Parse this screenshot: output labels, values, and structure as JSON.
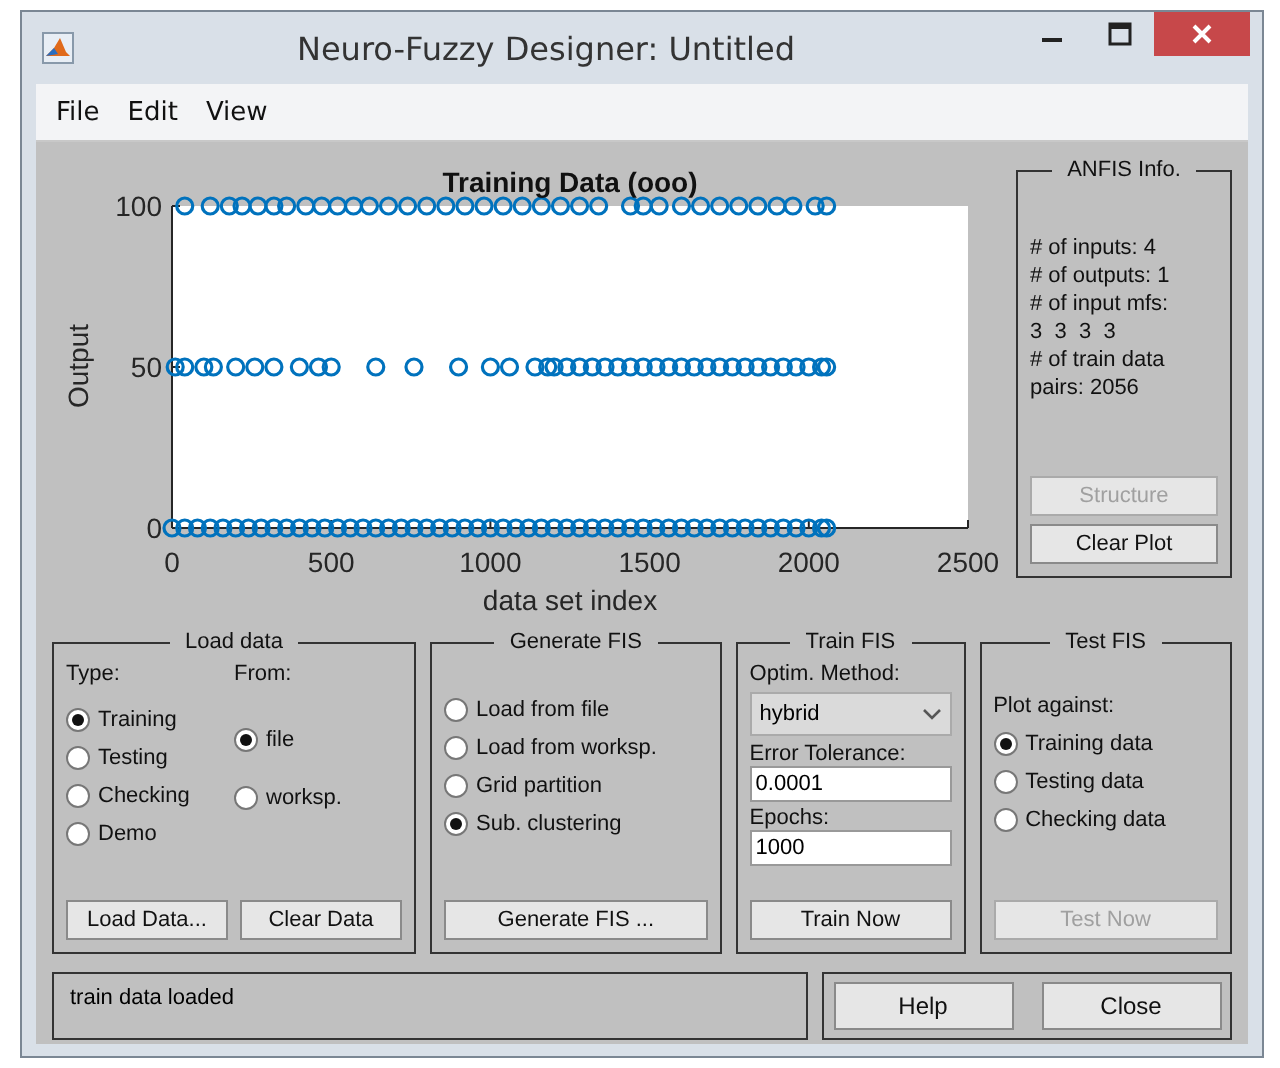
{
  "window": {
    "title": "Neuro-Fuzzy Designer: Untitled"
  },
  "menu": [
    "File",
    "Edit",
    "View"
  ],
  "plot": {
    "chart_data": {
      "type": "scatter",
      "title": "Training Data (ooo)",
      "xlabel": "data set index",
      "ylabel": "Output",
      "xlim": [
        0,
        2500
      ],
      "ylim": [
        0,
        100
      ],
      "xticks": [
        0,
        500,
        1000,
        1500,
        2000,
        2500
      ],
      "yticks": [
        0,
        50,
        100
      ],
      "series": [
        {
          "color": "#0072bd",
          "x": [
            0,
            40,
            80,
            120,
            160,
            200,
            240,
            280,
            320,
            360,
            400,
            440,
            480,
            520,
            560,
            600,
            640,
            680,
            720,
            760,
            800,
            840,
            880,
            920,
            960,
            1000,
            1040,
            1080,
            1120,
            1160,
            1200,
            1240,
            1280,
            1320,
            1360,
            1400,
            1440,
            1480,
            1520,
            1560,
            1600,
            1640,
            1680,
            1720,
            1760,
            1800,
            1840,
            1880,
            1920,
            1960,
            2000,
            2040,
            2056
          ],
          "values": [
            0,
            0,
            0,
            0,
            0,
            0,
            0,
            0,
            0,
            0,
            0,
            0,
            0,
            0,
            0,
            0,
            0,
            0,
            0,
            0,
            0,
            0,
            0,
            0,
            0,
            0,
            0,
            0,
            0,
            0,
            0,
            0,
            0,
            0,
            0,
            0,
            0,
            0,
            0,
            0,
            0,
            0,
            0,
            0,
            0,
            0,
            0,
            0,
            0,
            0,
            0,
            0,
            0
          ]
        },
        {
          "color": "#0072bd",
          "x": [
            10,
            40,
            100,
            130,
            200,
            260,
            320,
            400,
            460,
            500,
            640,
            760,
            900,
            1000,
            1060,
            1140,
            1180,
            1200,
            1240,
            1280,
            1320,
            1360,
            1400,
            1440,
            1480,
            1520,
            1560,
            1600,
            1640,
            1680,
            1720,
            1760,
            1800,
            1840,
            1880,
            1920,
            1960,
            2000,
            2040,
            2056
          ],
          "values": [
            50,
            50,
            50,
            50,
            50,
            50,
            50,
            50,
            50,
            50,
            50,
            50,
            50,
            50,
            50,
            50,
            50,
            50,
            50,
            50,
            50,
            50,
            50,
            50,
            50,
            50,
            50,
            50,
            50,
            50,
            50,
            50,
            50,
            50,
            50,
            50,
            50,
            50,
            50,
            50
          ]
        },
        {
          "color": "#0072bd",
          "x": [
            40,
            120,
            180,
            220,
            270,
            320,
            360,
            420,
            470,
            520,
            570,
            620,
            680,
            740,
            800,
            860,
            920,
            980,
            1040,
            1100,
            1160,
            1220,
            1280,
            1340,
            1440,
            1480,
            1530,
            1600,
            1660,
            1720,
            1780,
            1840,
            1900,
            1950,
            2020,
            2056
          ],
          "values": [
            100,
            100,
            100,
            100,
            100,
            100,
            100,
            100,
            100,
            100,
            100,
            100,
            100,
            100,
            100,
            100,
            100,
            100,
            100,
            100,
            100,
            100,
            100,
            100,
            100,
            100,
            100,
            100,
            100,
            100,
            100,
            100,
            100,
            100,
            100,
            100
          ]
        }
      ]
    }
  },
  "anfis_info": {
    "title": "ANFIS Info.",
    "lines": [
      "# of inputs: 4",
      "# of outputs: 1",
      "# of input mfs:",
      "3  3  3  3",
      "# of train data",
      "pairs: 2056"
    ],
    "buttons": [
      {
        "label": "Structure",
        "disabled": true
      },
      {
        "label": "Clear Plot",
        "disabled": false
      }
    ]
  },
  "load_data": {
    "title": "Load data",
    "type_label": "Type:",
    "from_label": "From:",
    "type_options": [
      {
        "label": "Training",
        "selected": true
      },
      {
        "label": "Testing",
        "selected": false
      },
      {
        "label": "Checking",
        "selected": false
      },
      {
        "label": "Demo",
        "selected": false
      }
    ],
    "from_options": [
      {
        "label": "file",
        "selected": true
      },
      {
        "label": "worksp.",
        "selected": false
      }
    ],
    "buttons": [
      {
        "label": "Load Data...",
        "disabled": false
      },
      {
        "label": "Clear Data",
        "disabled": false
      }
    ]
  },
  "generate_fis": {
    "title": "Generate FIS",
    "options": [
      {
        "label": "Load from file",
        "selected": false
      },
      {
        "label": "Load from worksp.",
        "selected": false
      },
      {
        "label": "Grid partition",
        "selected": false
      },
      {
        "label": "Sub. clustering",
        "selected": true
      }
    ],
    "button": {
      "label": "Generate FIS ...",
      "disabled": false
    }
  },
  "train_fis": {
    "title": "Train FIS",
    "method_label": "Optim. Method:",
    "method": "hybrid",
    "tolerance_label": "Error Tolerance:",
    "tolerance": "0.0001",
    "epochs_label": "Epochs:",
    "epochs": "1000",
    "button": {
      "label": "Train Now",
      "disabled": false
    }
  },
  "test_fis": {
    "title": "Test FIS",
    "plot_against_label": "Plot against:",
    "options": [
      {
        "label": "Training data",
        "selected": true
      },
      {
        "label": "Testing data",
        "selected": false
      },
      {
        "label": "Checking data",
        "selected": false
      }
    ],
    "button": {
      "label": "Test Now",
      "disabled": true
    }
  },
  "status": "train data loaded",
  "buttons": [
    {
      "label": "Help",
      "disabled": false
    },
    {
      "label": "Close",
      "disabled": false
    }
  ]
}
